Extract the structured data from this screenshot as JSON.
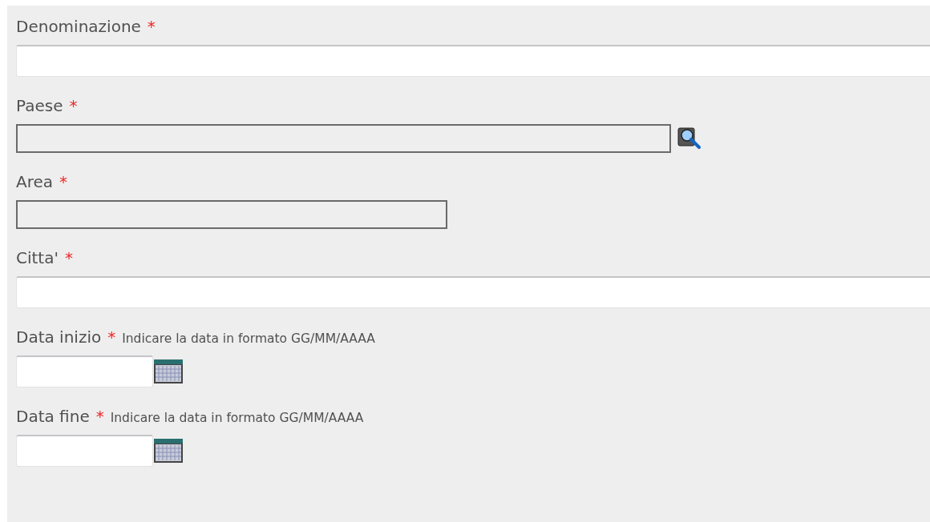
{
  "fields": [
    {
      "kind": "text",
      "label": "Denominazione",
      "required_mark": "*"
    },
    {
      "kind": "lookup",
      "label": "Paese",
      "required_mark": "*"
    },
    {
      "kind": "readonly",
      "label": "Area",
      "required_mark": "*"
    },
    {
      "kind": "text",
      "label": "Citta'",
      "required_mark": "*"
    },
    {
      "kind": "date",
      "label": "Data inizio",
      "required_mark": "*",
      "hint": "Indicare la data in formato GG/MM/AAAA"
    },
    {
      "kind": "date",
      "label": "Data fine",
      "required_mark": "*",
      "hint": "Indicare la data in formato GG/MM/AAAA"
    }
  ]
}
